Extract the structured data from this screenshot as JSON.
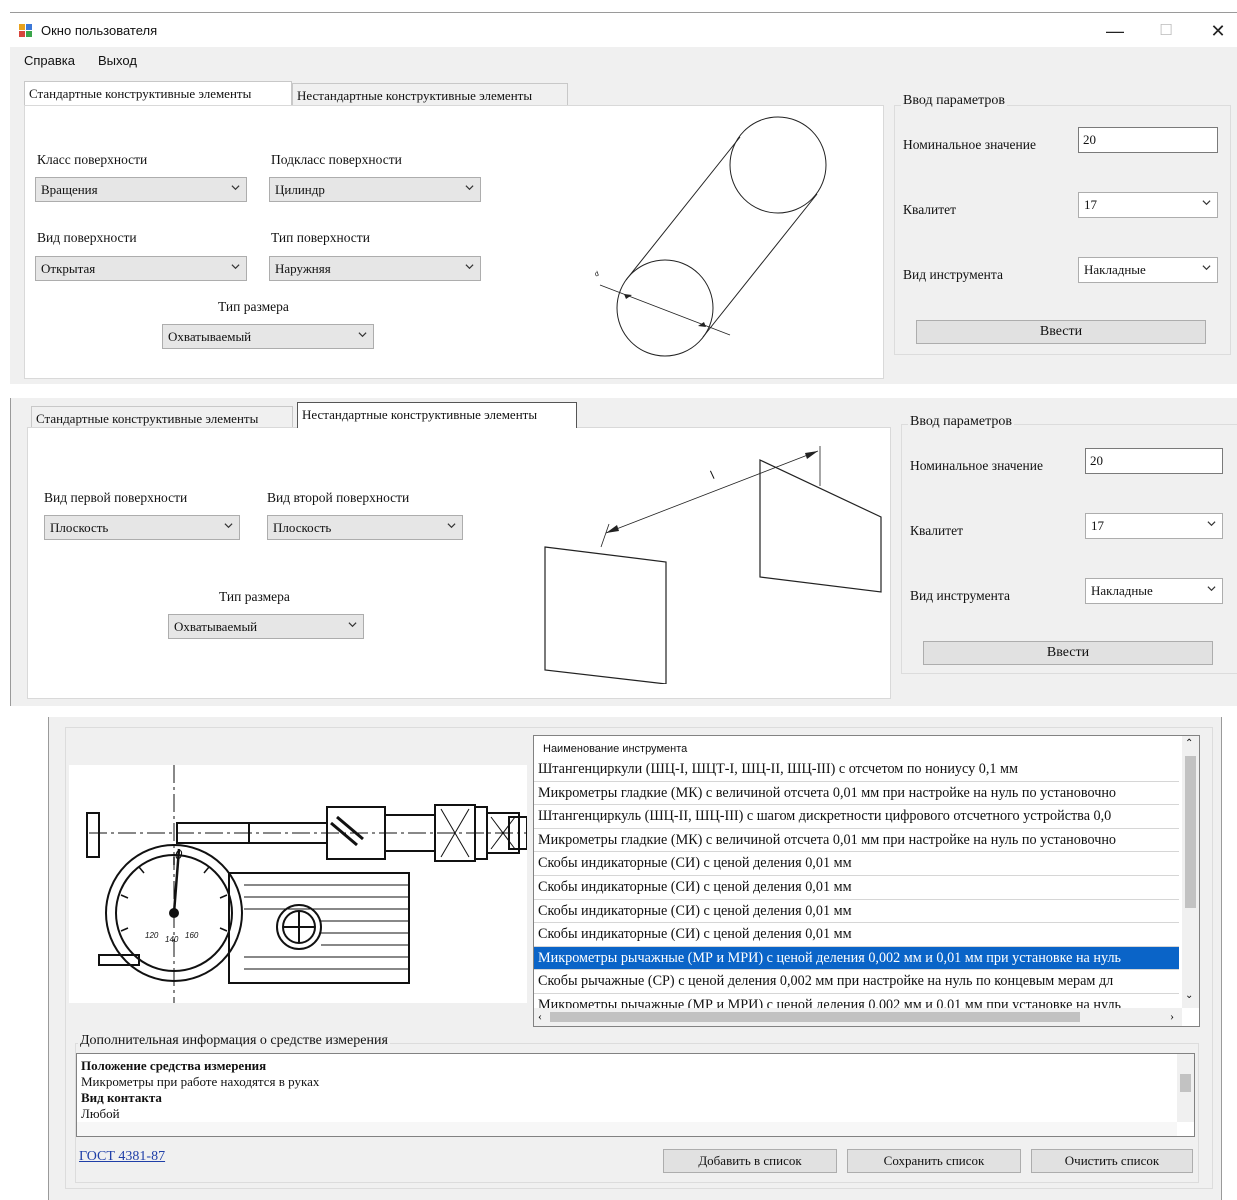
{
  "window": {
    "title": "Окно пользователя",
    "minimize_glyph": "—",
    "maximize_glyph": "☐",
    "close_glyph": "✕"
  },
  "menu": {
    "help": "Справка",
    "exit": "Выход"
  },
  "tabs": {
    "standard": "Стандартные конструктивные элементы",
    "nonstandard": "Нестандартные конструктивные элементы"
  },
  "standard_panel": {
    "surface_class_label": "Класс поверхности",
    "surface_class_value": "Вращения",
    "surface_subclass_label": "Подкласс поверхности",
    "surface_subclass_value": "Цилиндр",
    "surface_kind_label": "Вид поверхности",
    "surface_kind_value": "Открытая",
    "surface_type_label": "Тип поверхности",
    "surface_type_value": "Наружняя",
    "size_type_label": "Тип размера",
    "size_type_value": "Охватываемый",
    "dimension_mark": "d"
  },
  "nonstandard_panel": {
    "first_surface_label": "Вид первой поверхности",
    "first_surface_value": "Плоскость",
    "second_surface_label": "Вид второй поверхности",
    "second_surface_value": "Плоскость",
    "size_type_label": "Тип размера",
    "size_type_value": "Охватываемый",
    "dimension_mark": "l"
  },
  "params_1": {
    "group_title": "Ввод параметров",
    "nominal_label": "Номинальное значение",
    "nominal_value": "20",
    "grade_label": "Квалитет",
    "grade_value": "17",
    "tool_label": "Вид инструмента",
    "tool_value": "Накладные",
    "submit": "Ввести"
  },
  "params_2": {
    "group_title": "Ввод параметров",
    "nominal_label": "Номинальное значение",
    "nominal_value": "20",
    "grade_label": "Квалитет",
    "grade_value": "17",
    "tool_label": "Вид инструмента",
    "tool_value": "Накладные",
    "submit": "Ввести"
  },
  "instrument_list": {
    "header": "Наименование инструмента",
    "items": [
      "Штангенциркули (ШЦ-I, ШЦТ-I, ШЦ-II, ШЦ-III) с отсчетом по нониусу 0,1 мм",
      "Микрометры гладкие (МК) с величиной отсчета 0,01 мм при настройке на нуль по установочно",
      "Штангенциркуль (ШЦ-II, ШЦ-III) с шагом дискретности цифрового отсчетного устройства 0,0",
      "Микрометры гладкие (МК) с величиной отсчета 0,01 мм при настройке на нуль по установочно",
      "Скобы индикаторные (СИ) с ценой деления 0,01 мм",
      "Скобы индикаторные (СИ) с ценой деления 0,01 мм",
      "Скобы индикаторные (СИ) с ценой деления 0,01 мм",
      "Скобы индикаторные (СИ) с ценой деления 0,01 мм",
      "Микрометры рычажные (МР и МРИ) с ценой деления 0,002 мм и 0,01 мм при установке на нуль",
      "Скобы рычажные (СР) с ценой деления 0,002 мм при настройке на нуль по концевым мерам дл",
      "Микрометры рычажные (МР и МРИ) с ценой деления 0,002 мм и 0,01 мм при установке на нуль"
    ],
    "selected_index": 8
  },
  "drawing": {
    "dial_labels": [
      "0",
      "120",
      "140",
      "160"
    ]
  },
  "additional_info": {
    "group_title": "Дополнительная информация о средстве измерения",
    "position_heading": "Положение средства измерения",
    "position_text": "Микрометры при работе находятся в руках",
    "contact_heading": "Вид контакта",
    "contact_text": "Любой"
  },
  "footer": {
    "gost_link": "ГОСТ 4381-87",
    "add_button": "Добавить в список",
    "save_button": "Сохранить список",
    "clear_button": "Очистить список"
  }
}
